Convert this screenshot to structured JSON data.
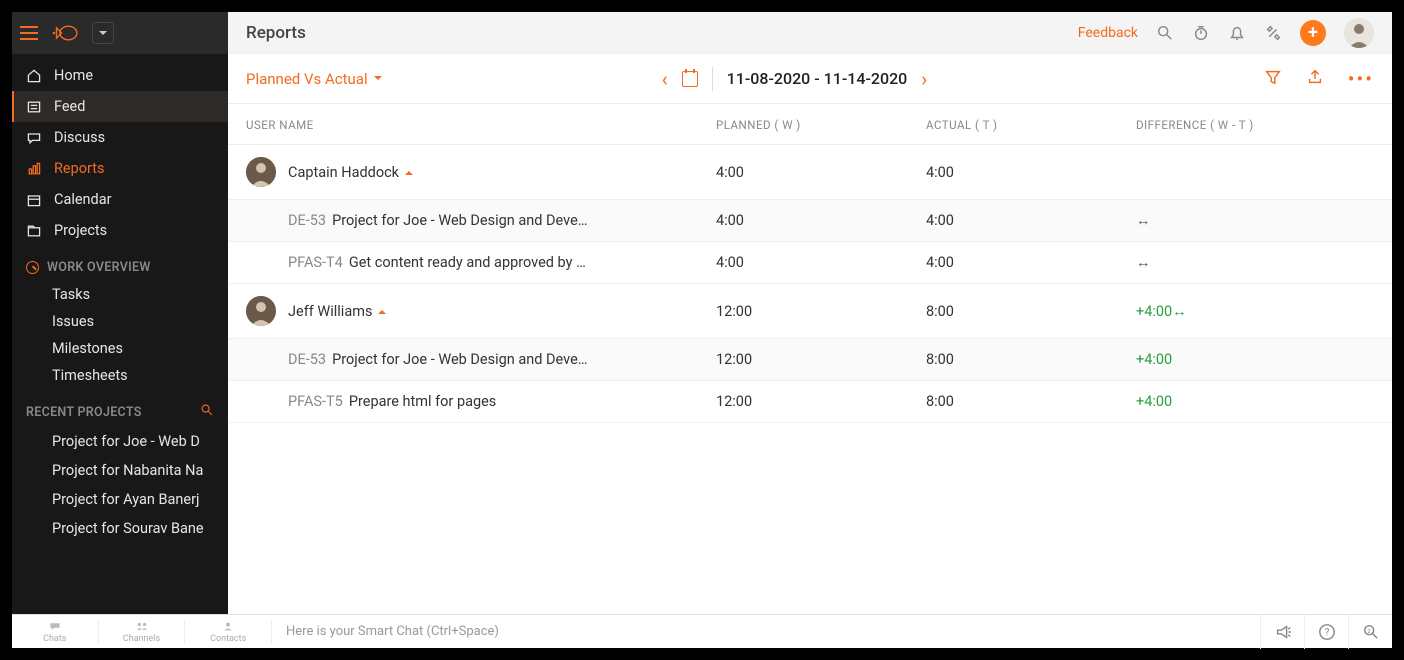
{
  "header": {
    "title": "Reports",
    "feedback": "Feedback"
  },
  "sidebar": {
    "nav": [
      {
        "label": "Home"
      },
      {
        "label": "Feed"
      },
      {
        "label": "Discuss"
      },
      {
        "label": "Reports"
      },
      {
        "label": "Calendar"
      },
      {
        "label": "Projects"
      }
    ],
    "work_overview_title": "WORK OVERVIEW",
    "work_overview": [
      {
        "label": "Tasks"
      },
      {
        "label": "Issues"
      },
      {
        "label": "Milestones"
      },
      {
        "label": "Timesheets"
      }
    ],
    "recent_projects_title": "RECENT PROJECTS",
    "recent_projects": [
      {
        "label": "Project for Joe - Web D"
      },
      {
        "label": "Project for Nabanita Na"
      },
      {
        "label": "Project for Ayan Banerj"
      },
      {
        "label": "Project for Sourav Bane"
      }
    ]
  },
  "subheader": {
    "report_type": "Planned Vs Actual",
    "date_range": "11-08-2020 - 11-14-2020"
  },
  "columns": {
    "user": "USER NAME",
    "planned": "PLANNED ( W )",
    "actual": "ACTUAL ( T )",
    "diff": "DIFFERENCE ( W - T )"
  },
  "rows": [
    {
      "type": "user",
      "name": "Captain Haddock",
      "planned": "4:00",
      "actual": "4:00",
      "diff": ""
    },
    {
      "type": "task",
      "shade": true,
      "id": "DE-53",
      "name": "Project for Joe - Web Design and Deve…",
      "planned": "4:00",
      "actual": "4:00",
      "diff_swap": true
    },
    {
      "type": "task",
      "id": "PFAS-T4",
      "name": "Get content ready and approved by …",
      "planned": "4:00",
      "actual": "4:00",
      "diff_swap": true
    },
    {
      "type": "user",
      "name": "Jeff Williams",
      "planned": "12:00",
      "actual": "8:00",
      "diff": "+4:00",
      "diff_pos": true,
      "diff_swap": true
    },
    {
      "type": "task",
      "shade": true,
      "id": "DE-53",
      "name": "Project for Joe - Web Design and Deve…",
      "planned": "12:00",
      "actual": "8:00",
      "diff": "+4:00",
      "diff_pos": true
    },
    {
      "type": "task",
      "id": "PFAS-T5",
      "name": "Prepare html for pages",
      "planned": "12:00",
      "actual": "8:00",
      "diff": "+4:00",
      "diff_pos": true
    }
  ],
  "bottom": {
    "tabs": [
      {
        "label": "Chats"
      },
      {
        "label": "Channels"
      },
      {
        "label": "Contacts"
      }
    ],
    "smartchat": "Here is your Smart Chat (Ctrl+Space)"
  }
}
